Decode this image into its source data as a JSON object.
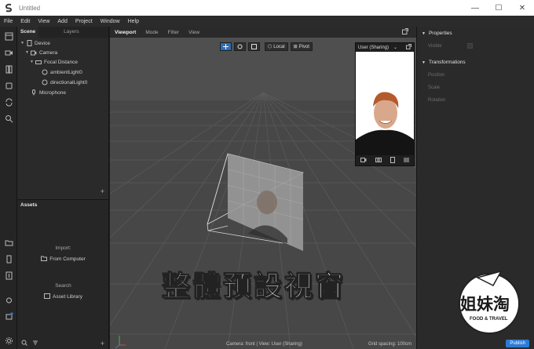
{
  "window": {
    "title": "Untitled",
    "controls": [
      "—",
      "☐",
      "✕"
    ]
  },
  "menu": [
    "File",
    "Edit",
    "View",
    "Add",
    "Project",
    "Window",
    "Help"
  ],
  "scene_panel": {
    "tabs": [
      "Scene",
      "Layers"
    ],
    "tree": [
      {
        "label": "Device",
        "icon": "device-icon"
      },
      {
        "label": "Camera",
        "icon": "camera-icon"
      },
      {
        "label": "Focal Distance",
        "icon": "focal-icon"
      },
      {
        "label": "ambientLight0",
        "icon": "light-icon"
      },
      {
        "label": "directionalLight0",
        "icon": "light-icon"
      },
      {
        "label": "Microphone",
        "icon": "microphone-icon"
      }
    ],
    "add": "+"
  },
  "assets_panel": {
    "title": "Assets",
    "import_label": "Import:",
    "from_computer": "From Computer",
    "search_label": "Search",
    "asset_library": "Asset Library",
    "add": "+"
  },
  "viewport": {
    "tabs": [
      "Viewport",
      "Mode",
      "Filter",
      "View"
    ],
    "tools": {
      "local": "Local",
      "pivot": "Pivot"
    },
    "preview_title": "User (Sharing)",
    "status_left": "Camera: front | View: User (Sharing)",
    "status_right": "Grid spacing: 100cm",
    "caption": "整體預設視窗"
  },
  "properties_panel": {
    "properties_title": "Properties",
    "visible_label": "Visible",
    "transformations_title": "Transformations",
    "rows": [
      "Position",
      "Scale",
      "Rotation"
    ],
    "publish": "Publish"
  },
  "watermark": {
    "logo_text": "姐妹淘",
    "sub_text": "FOOD & TRAVEL"
  },
  "colors": {
    "accent": "#2d7ad6",
    "viewport_bg": "#474747",
    "panel_bg": "#2a2a2a"
  }
}
